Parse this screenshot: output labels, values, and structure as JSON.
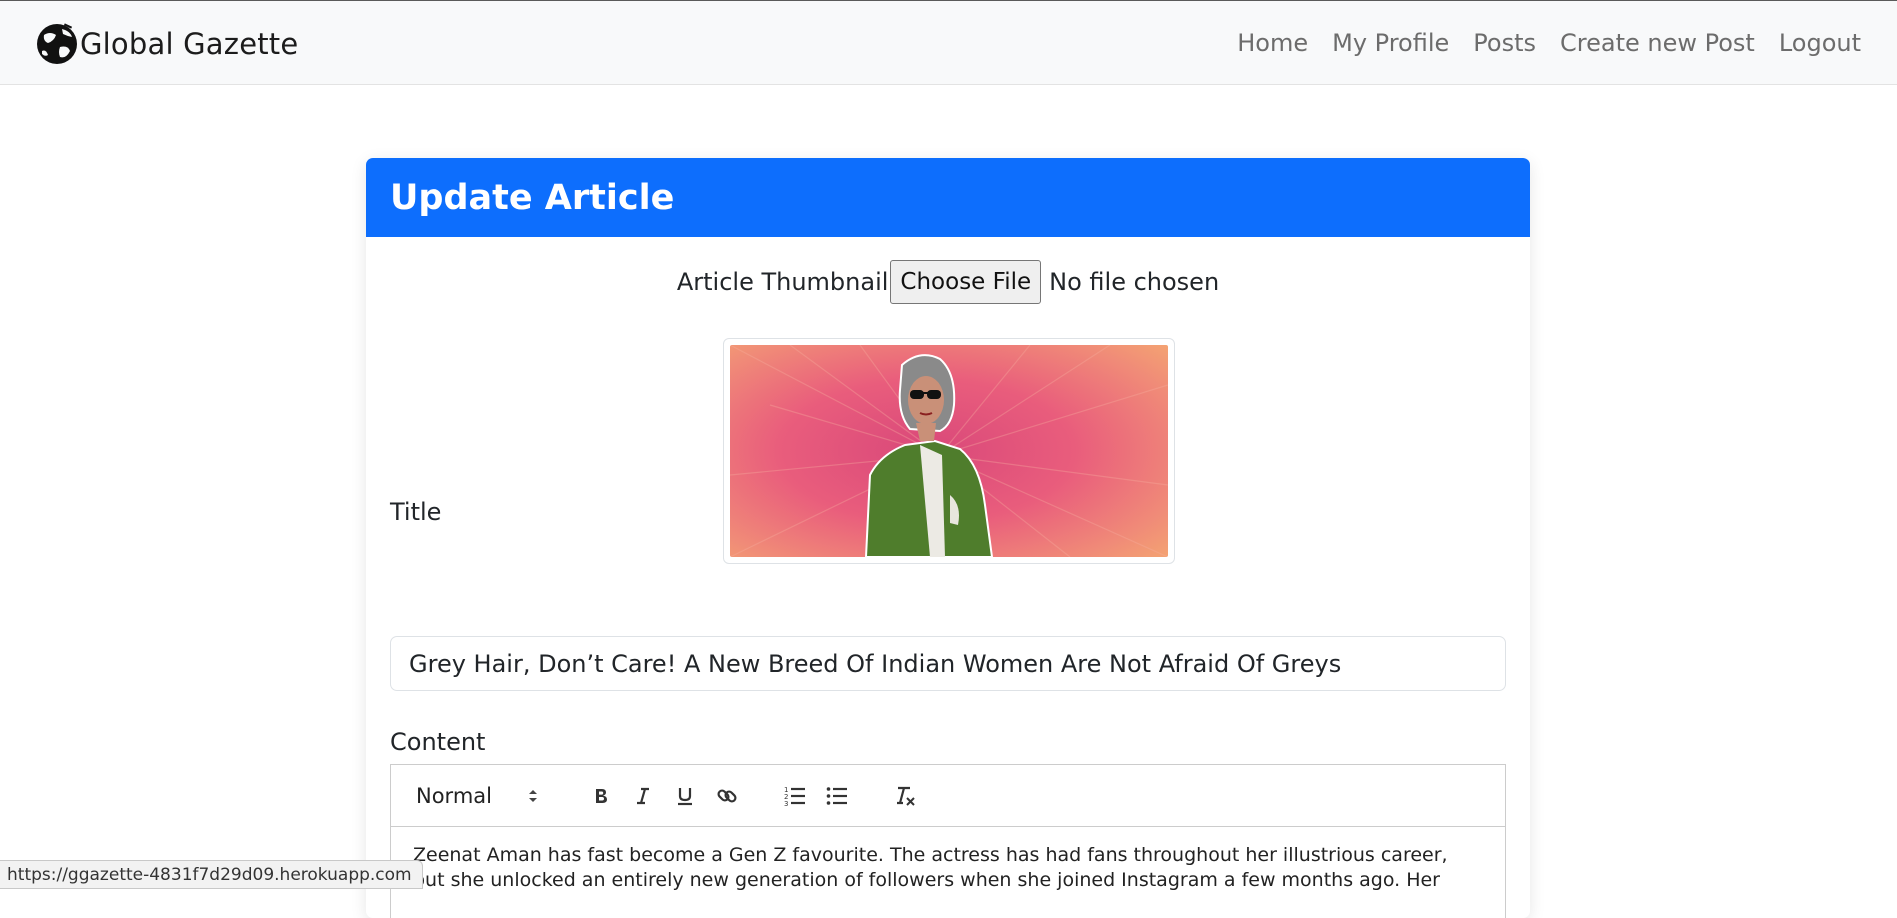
{
  "navbar": {
    "brand": "Global Gazette",
    "links": [
      "Home",
      "My Profile",
      "Posts",
      "Create new Post",
      "Logout"
    ]
  },
  "card": {
    "title": "Update Article",
    "thumbnail_label": "Article Thumbnail",
    "file_button": "Choose File",
    "file_status": "No file chosen",
    "title_label": "Title",
    "title_value": "Grey Hair, Don’t Care! A New Breed Of Indian Women Are Not Afraid Of Greys",
    "content_label": "Content",
    "editor": {
      "format_select": "Normal",
      "tools": [
        "bold-icon",
        "italic-icon",
        "underline-icon",
        "link-icon",
        "ordered-list-icon",
        "bullet-list-icon",
        "clear-format-icon"
      ],
      "content": "Zeenat Aman has fast become a Gen Z favourite. The actress has had fans throughout her illustrious career, but she unlocked an entirely new generation of followers when she joined Instagram a few months ago. Her"
    }
  },
  "status_bar": {
    "url": "https://ggazette-4831f7d29d09.herokuapp.com"
  },
  "colors": {
    "primary": "#0d6efd",
    "navbar_bg": "#f8f9fa"
  }
}
